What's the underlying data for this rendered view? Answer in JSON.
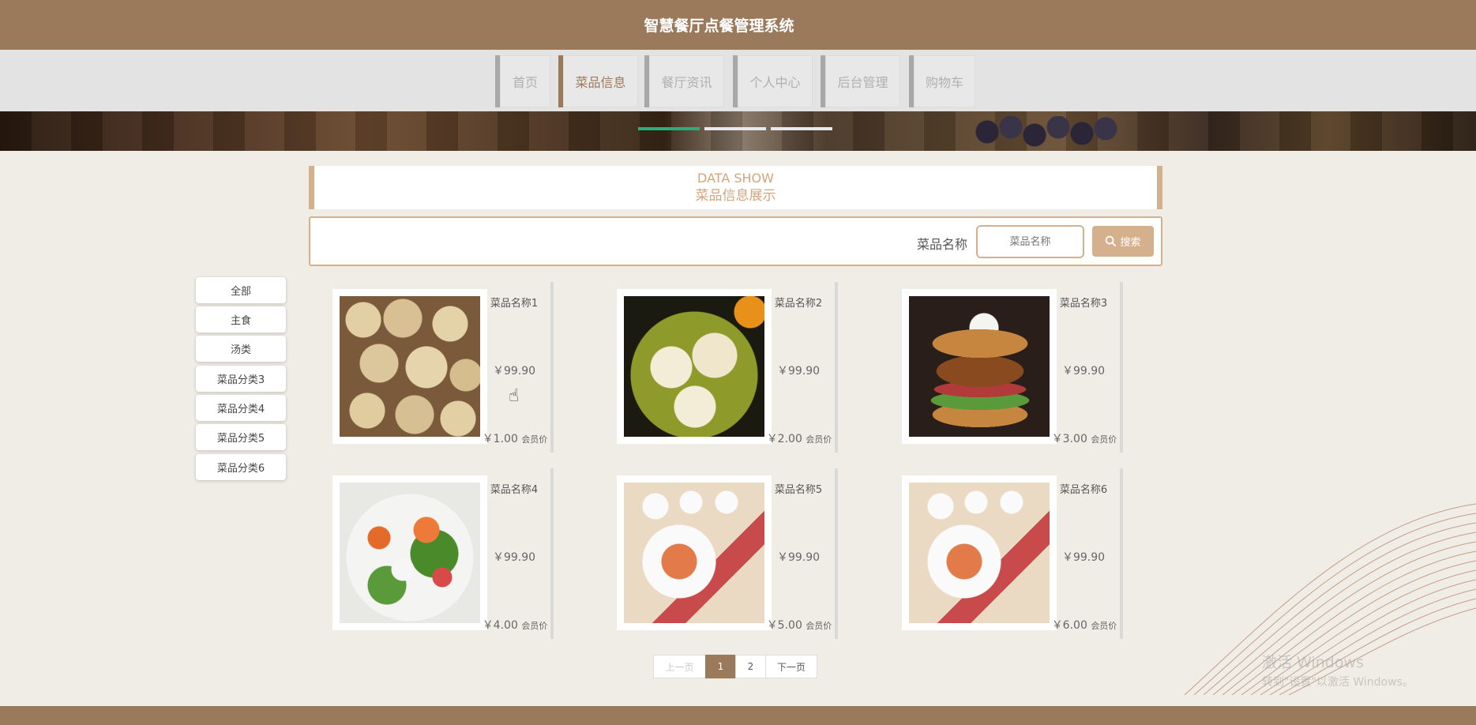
{
  "header": {
    "title": "智慧餐厅点餐管理系统"
  },
  "nav": {
    "items": [
      {
        "label": "首页"
      },
      {
        "label": "菜品信息"
      },
      {
        "label": "餐厅资讯"
      },
      {
        "label": "个人中心"
      },
      {
        "label": "后台管理"
      },
      {
        "label": "购物车"
      }
    ],
    "active_index": 1
  },
  "banner": {
    "slide_count": 3,
    "active_slide": 0
  },
  "section": {
    "title_en": "DATA SHOW",
    "title_cn": "菜品信息展示"
  },
  "search": {
    "label": "菜品名称",
    "placeholder": "菜品名称",
    "button_label": "搜索"
  },
  "categories": [
    "全部",
    "主食",
    "汤类",
    "菜品分类3",
    "菜品分类4",
    "菜品分类5",
    "菜品分类6"
  ],
  "products": [
    {
      "name": "菜品名称1",
      "price": "￥99.90",
      "vip_price": "￥1.00",
      "vip_tag": "会员价",
      "image": "dumplings"
    },
    {
      "name": "菜品名称2",
      "price": "￥99.90",
      "vip_price": "￥2.00",
      "vip_tag": "会员价",
      "image": "dim-sum"
    },
    {
      "name": "菜品名称3",
      "price": "￥99.90",
      "vip_price": "￥3.00",
      "vip_tag": "会员价",
      "image": "burger"
    },
    {
      "name": "菜品名称4",
      "price": "￥99.90",
      "vip_price": "￥4.00",
      "vip_tag": "会员价",
      "image": "salad"
    },
    {
      "name": "菜品名称5",
      "price": "￥99.90",
      "vip_price": "￥5.00",
      "vip_tag": "会员价",
      "image": "rice-bowl"
    },
    {
      "name": "菜品名称6",
      "price": "￥99.90",
      "vip_price": "￥6.00",
      "vip_tag": "会员价",
      "image": "rice-bowl"
    }
  ],
  "pagination": {
    "prev_label": "上一页",
    "pages": [
      "1",
      "2"
    ],
    "current": "1",
    "next_label": "下一页"
  },
  "watermark": {
    "line1": "激活 Windows",
    "line2": "转到\"设置\"以激活 Windows。"
  },
  "colors": {
    "brand": "#9b7a5b",
    "accent": "#d5b08c",
    "slide_active": "#2cae7a"
  }
}
